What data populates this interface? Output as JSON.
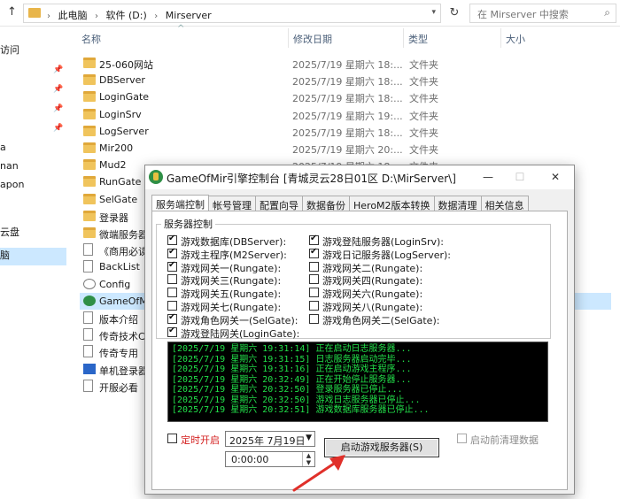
{
  "explorer": {
    "breadcrumbs": [
      "此电脑",
      "软件 (D:)",
      "Mirserver"
    ],
    "search_placeholder": "在 Mirserver 中搜索",
    "nav_items": [
      "访问",
      "",
      "",
      "",
      "",
      "a",
      "nan",
      "apon",
      "",
      "云盘",
      "",
      "脑"
    ],
    "columns": {
      "name": "名称",
      "date": "修改日期",
      "type": "类型",
      "size": "大小"
    },
    "rows": [
      {
        "name": "25-060网站",
        "date": "2025/7/19 星期六 18:...",
        "type": "文件夹",
        "icon": "folder-icon"
      },
      {
        "name": "DBServer",
        "date": "2025/7/19 星期六 18:...",
        "type": "文件夹",
        "icon": "folder-icon"
      },
      {
        "name": "LoginGate",
        "date": "2025/7/19 星期六 18:...",
        "type": "文件夹",
        "icon": "folder-icon"
      },
      {
        "name": "LoginSrv",
        "date": "2025/7/19 星期六 19:...",
        "type": "文件夹",
        "icon": "folder-icon"
      },
      {
        "name": "LogServer",
        "date": "2025/7/19 星期六 18:...",
        "type": "文件夹",
        "icon": "folder-icon"
      },
      {
        "name": "Mir200",
        "date": "2025/7/19 星期六 20:...",
        "type": "文件夹",
        "icon": "folder-icon"
      },
      {
        "name": "Mud2",
        "date": "2025/7/19 星期六 18:...",
        "type": "文件夹",
        "icon": "folder-icon"
      },
      {
        "name": "RunGate",
        "date": "",
        "type": "",
        "icon": "folder-icon"
      },
      {
        "name": "SelGate",
        "date": "",
        "type": "",
        "icon": "folder-icon"
      },
      {
        "name": "登录器",
        "date": "",
        "type": "",
        "icon": "folder-icon"
      },
      {
        "name": "微端服务器",
        "date": "",
        "type": "",
        "icon": "folder-icon"
      },
      {
        "name": "《商用必读",
        "date": "",
        "type": "",
        "icon": "file-icon"
      },
      {
        "name": "BackList",
        "date": "",
        "type": "",
        "icon": "file-icon"
      },
      {
        "name": "Config",
        "date": "",
        "type": "",
        "icon": "config-icon"
      },
      {
        "name": "GameOfM",
        "date": "",
        "type": "",
        "icon": "app-icon"
      },
      {
        "name": "版本介绍",
        "date": "",
        "type": "",
        "icon": "file-icon"
      },
      {
        "name": "传奇技术C",
        "date": "",
        "type": "",
        "icon": "file-icon"
      },
      {
        "name": "传奇专用",
        "date": "",
        "type": "",
        "icon": "file-icon"
      },
      {
        "name": "单机登录器",
        "date": "",
        "type": "",
        "icon": "app2-icon"
      },
      {
        "name": "开服必看",
        "date": "",
        "type": "",
        "icon": "file-icon"
      }
    ]
  },
  "dialog": {
    "title": "GameOfMir引擎控制台 [青城灵云28日01区 D:\\MirServer\\]",
    "tabs": [
      "服务端控制",
      "帐号管理",
      "配置向导",
      "数据备份",
      "HeroM2版本转换",
      "数据清理",
      "相关信息"
    ],
    "group_label": "服务器控制",
    "checkboxes_left": [
      {
        "label": "游戏数据库(DBServer):",
        "checked": true
      },
      {
        "label": "游戏主程序(M2Server):",
        "checked": true
      },
      {
        "label": "游戏网关一(Rungate):",
        "checked": true
      },
      {
        "label": "游戏网关三(Rungate):",
        "checked": false
      },
      {
        "label": "游戏网关五(Rungate):",
        "checked": false
      },
      {
        "label": "游戏网关七(Rungate):",
        "checked": false
      },
      {
        "label": "游戏角色网关一(SelGate):",
        "checked": true
      },
      {
        "label": "游戏登陆网关(LoginGate):",
        "checked": true
      }
    ],
    "checkboxes_right": [
      {
        "label": "游戏登陆服务器(LoginSrv):",
        "checked": true
      },
      {
        "label": "游戏日记服务器(LogServer):",
        "checked": true
      },
      {
        "label": "游戏网关二(Rungate):",
        "checked": false
      },
      {
        "label": "游戏网关四(Rungate):",
        "checked": false
      },
      {
        "label": "游戏网关六(Rungate):",
        "checked": false
      },
      {
        "label": "游戏网关八(Rungate):",
        "checked": false
      },
      {
        "label": "游戏角色网关二(SelGate):",
        "checked": false
      }
    ],
    "log_lines": [
      "[2025/7/19 星期六 19:31:14] 正在启动日志服务器...",
      "[2025/7/19 星期六 19:31:15] 日志服务器启动完毕...",
      "[2025/7/19 星期六 19:31:16] 正在启动游戏主程序...",
      "[2025/7/19 星期六 20:32:49] 正在开始停止服务器...",
      "[2025/7/19 星期六 20:32:50] 登录服务器已停止...",
      "[2025/7/19 星期六 20:32:50] 游戏日志服务器已停止...",
      "[2025/7/19 星期六 20:32:51] 游戏数据库服务器已停止..."
    ],
    "timer_label": "定时开启",
    "timer_checked": false,
    "date_value": "2025年 7月19日",
    "time_value": "0:00:00",
    "start_button": "启动游戏服务器(S)",
    "clean_label": "启动前清理数据",
    "clean_checked": false
  },
  "colors": {
    "log_text": "#22e04a",
    "timer_label": "#d42020",
    "annotation_arrow": "#e0302a"
  }
}
